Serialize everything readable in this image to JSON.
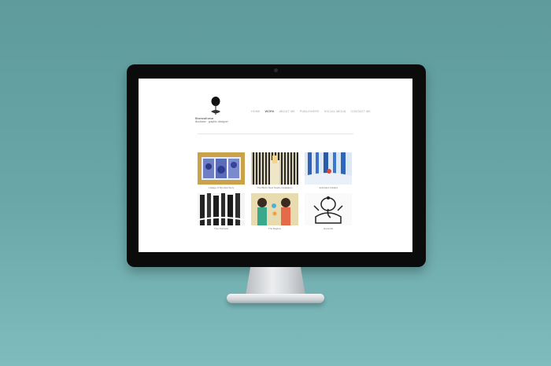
{
  "site": {
    "logo_name": "BhavanaKumar",
    "logo_subtitle": "illustrator · graphic designer"
  },
  "nav": [
    {
      "label": "HOME",
      "active": false
    },
    {
      "label": "WORK",
      "active": true
    },
    {
      "label": "ABOUT ME",
      "active": false
    },
    {
      "label": "PUBLISHERS",
      "active": false
    },
    {
      "label": "SOCIAL MEDIA",
      "active": false
    },
    {
      "label": "CONTACT ME",
      "active": false
    }
  ],
  "gallery": [
    {
      "caption": "Collage of Mumbai Story"
    },
    {
      "caption": "The Bird's Nest Studio installation"
    },
    {
      "caption": "Self-titled Untitled"
    },
    {
      "caption": "Tree Portraits"
    },
    {
      "caption": "The Bugbox"
    },
    {
      "caption": "Ganesha"
    }
  ],
  "colors": {
    "background": "#6aa7a9",
    "bezel": "#0b0b0c",
    "nav_active": "#222222",
    "nav_inactive": "#a2a2a2"
  }
}
